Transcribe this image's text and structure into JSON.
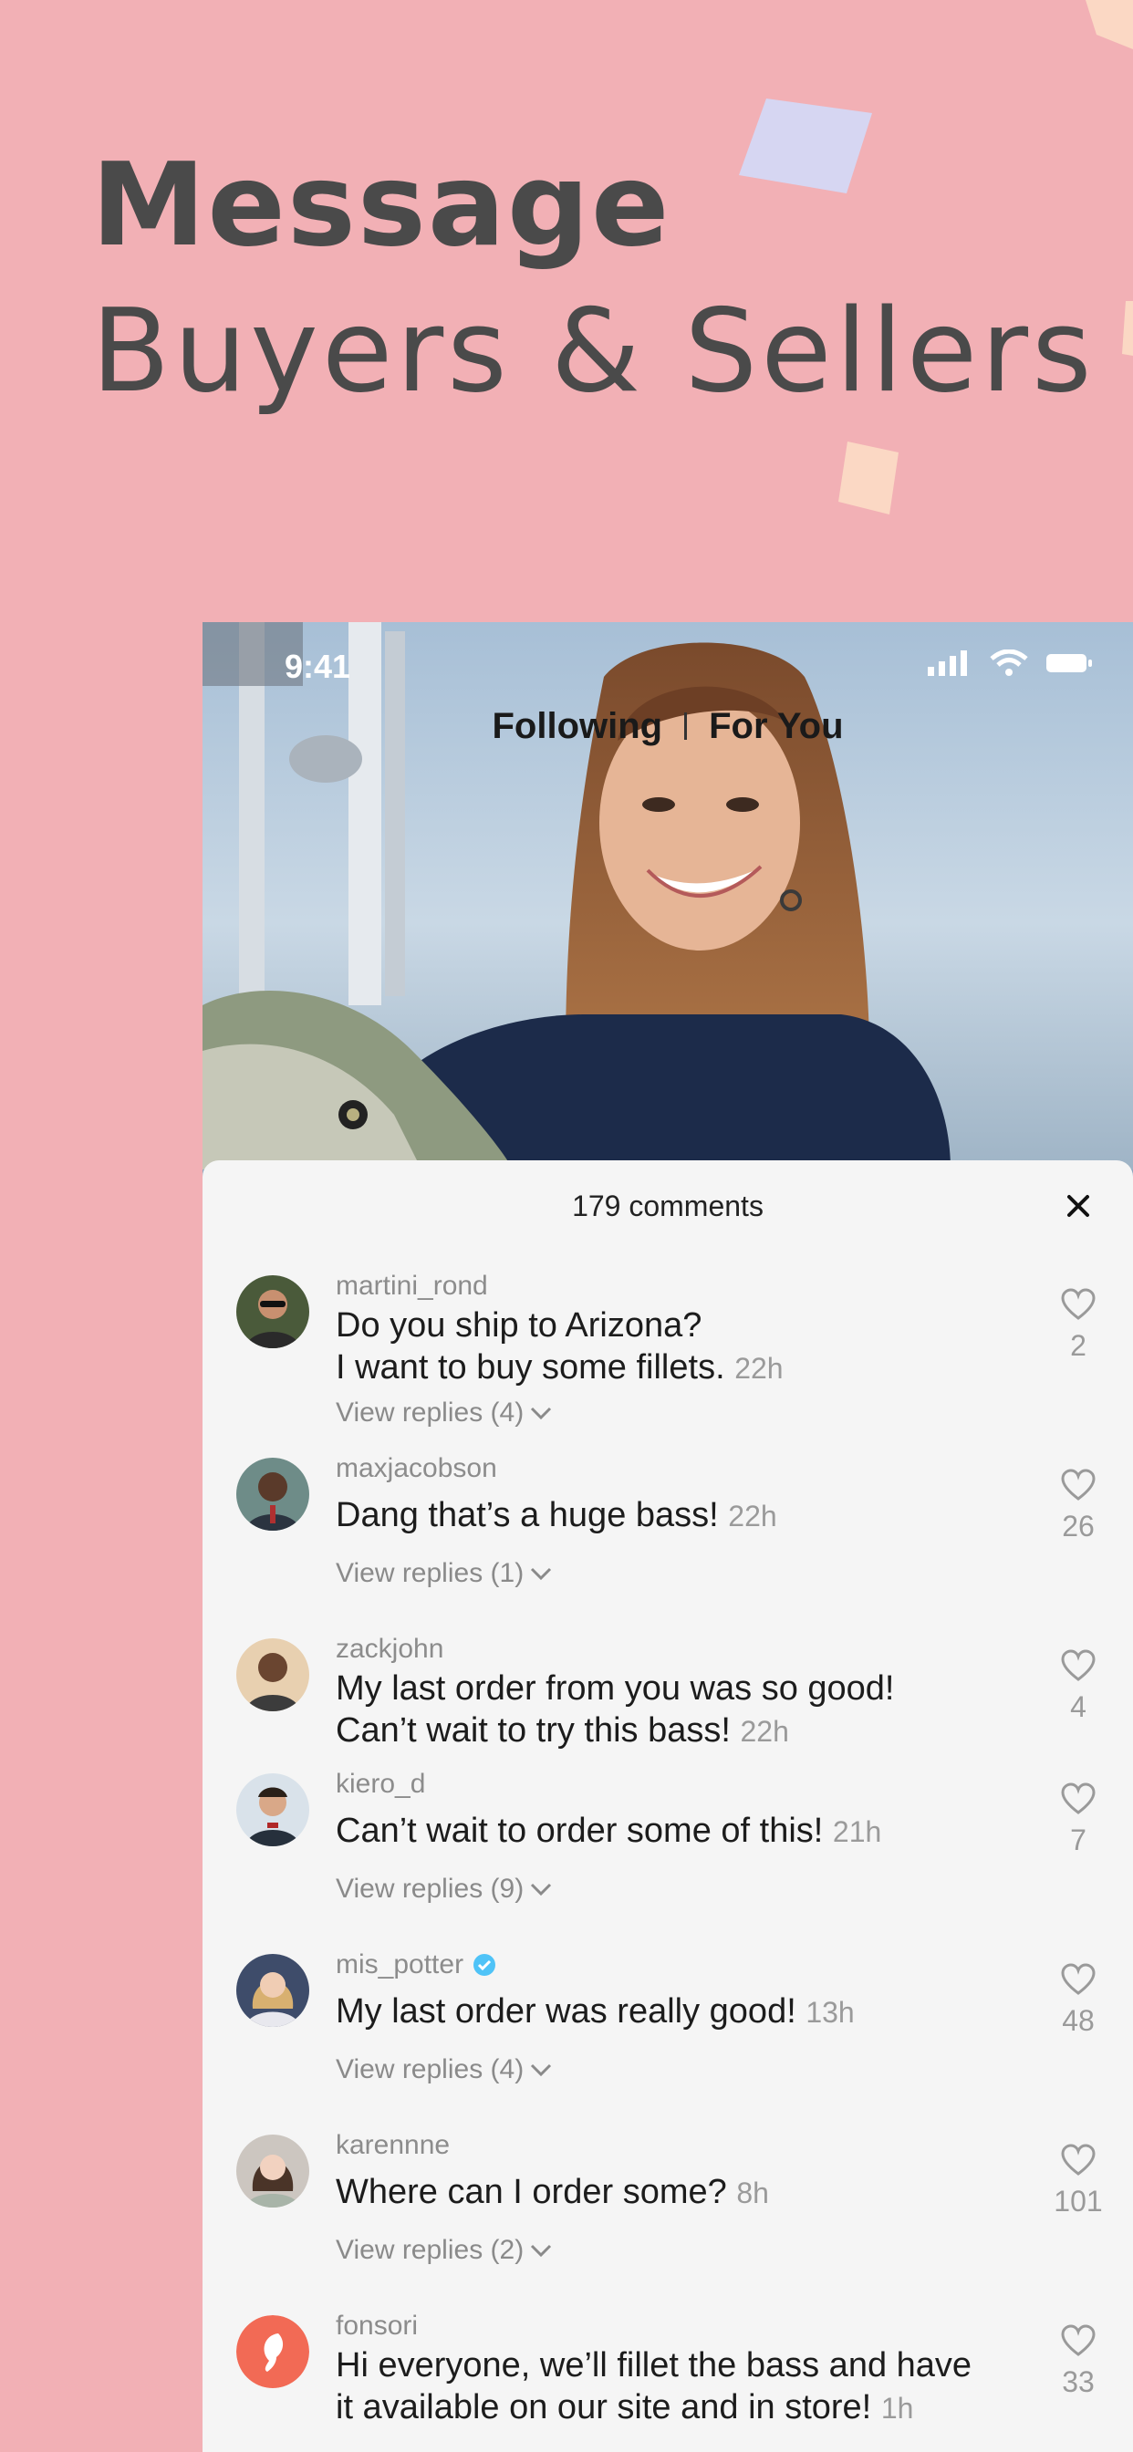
{
  "headline": {
    "line1": "Message",
    "line2": "Buyers & Sellers"
  },
  "colors": {
    "background": "#f2b0b5",
    "panel": "#f5f5f5",
    "verified": "#4fc3f7",
    "fonsori": "#f26a55"
  },
  "status_bar": {
    "time": "9:41",
    "icons": [
      "signal-icon",
      "wifi-icon",
      "battery-icon"
    ]
  },
  "feed_tabs": {
    "following": "Following",
    "for_you": "For You"
  },
  "comments_panel": {
    "count_label": "179 comments",
    "close_icon": "close-icon",
    "comments": [
      {
        "user": "martini_rond",
        "lines": [
          "Do you ship to Arizona?",
          "I want to buy some fillets."
        ],
        "time": "22h",
        "replies": "View replies (4)",
        "likes": "2"
      },
      {
        "user": "maxjacobson",
        "lines": [
          "Dang that’s a huge bass!"
        ],
        "time": "22h",
        "replies": "View replies (1)",
        "likes": "26"
      },
      {
        "user": "zackjohn",
        "lines": [
          "My last order from you was so good!",
          "Can’t wait to try this bass!"
        ],
        "time": "22h",
        "replies": "",
        "likes": "4"
      },
      {
        "user": "kiero_d",
        "lines": [
          "Can’t wait to order some of this!"
        ],
        "time": "21h",
        "replies": "View replies (9)",
        "likes": "7"
      },
      {
        "user": "mis_potter",
        "verified": true,
        "lines": [
          "My last order was really good!"
        ],
        "time": "13h",
        "replies": "View replies (4)",
        "likes": "48"
      },
      {
        "user": "karennne",
        "lines": [
          "Where can I order some?"
        ],
        "time": "8h",
        "replies": "View replies (2)",
        "likes": "101"
      },
      {
        "user": "fonsori",
        "lines": [
          "Hi everyone, we’ll fillet the bass and have",
          " it available on our site and in store!"
        ],
        "time": "1h",
        "replies": "",
        "likes": "33"
      }
    ]
  }
}
